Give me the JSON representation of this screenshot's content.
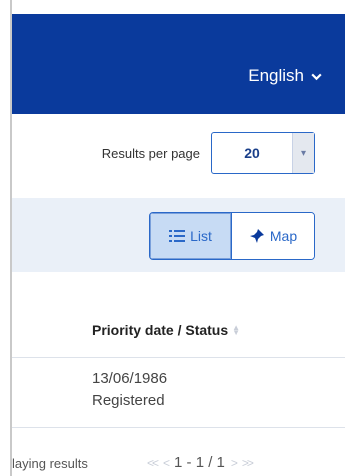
{
  "header": {
    "language_label": "English",
    "background": "#0a3a9c"
  },
  "toolbar": {
    "results_per_page_label": "Results per page",
    "results_per_page_value": "20"
  },
  "view": {
    "list_label": "List",
    "map_label": "Map",
    "active": "List"
  },
  "table": {
    "columns": [
      {
        "label": "Priority date / Status"
      }
    ],
    "rows": [
      {
        "date": "13/06/1986",
        "status": "Registered"
      }
    ]
  },
  "footer": {
    "displaying_text": "Displaying results",
    "first_symbol": "<<",
    "prev_symbol": "<",
    "range_text": "1 - 1 / 1",
    "next_symbol": ">",
    "last_symbol": ">>"
  }
}
